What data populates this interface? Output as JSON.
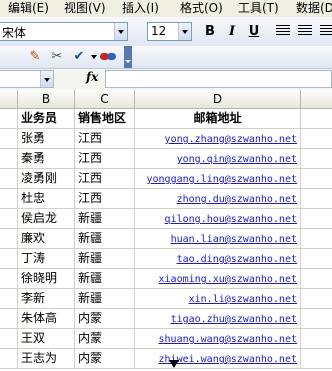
{
  "menu": [
    "编辑(E)",
    "视图(V)",
    "插入(I)",
    "格式(O)",
    "工具(T)",
    "数据(D)"
  ],
  "toolbar": {
    "font_name": "宋体",
    "font_size": "12",
    "bold": "B",
    "italic": "I",
    "underline": "U"
  },
  "formula_bar": {
    "name_box": "",
    "fx_label": "fx",
    "formula": ""
  },
  "columns": [
    "B",
    "C",
    "D"
  ],
  "header_row": {
    "b": "业务员",
    "c": "销售地区",
    "d": "邮箱地址"
  },
  "rows": [
    {
      "name": "张勇",
      "region": "江西",
      "email": "yong.zhang@szwanho.net"
    },
    {
      "name": "秦勇",
      "region": "江西",
      "email": "yong.qin@szwanho.net"
    },
    {
      "name": "凌勇刚",
      "region": "江西",
      "email": "yonggang.ling@szwanho.net"
    },
    {
      "name": "杜忠",
      "region": "江西",
      "email": "zhong.du@szwanho.net"
    },
    {
      "name": "侯启龙",
      "region": "新疆",
      "email": "qilong.hou@szwanho.net"
    },
    {
      "name": "廉欢",
      "region": "新疆",
      "email": "huan.lian@szwanho.net"
    },
    {
      "name": "丁涛",
      "region": "新疆",
      "email": "tao.ding@szwanho.net"
    },
    {
      "name": "徐晓明",
      "region": "新疆",
      "email": "xiaoming.xu@szwanho.net"
    },
    {
      "name": "李新",
      "region": "新疆",
      "email": "xin.li@szwanho.net"
    },
    {
      "name": "朱体高",
      "region": "内蒙",
      "email": "tigao.zhu@szwanho.net"
    },
    {
      "name": "王双",
      "region": "内蒙",
      "email": "shuang.wang@szwanho.net"
    },
    {
      "name": "王志为",
      "region": "内蒙",
      "email": "zhiwei.wang@szwanho.net"
    }
  ]
}
